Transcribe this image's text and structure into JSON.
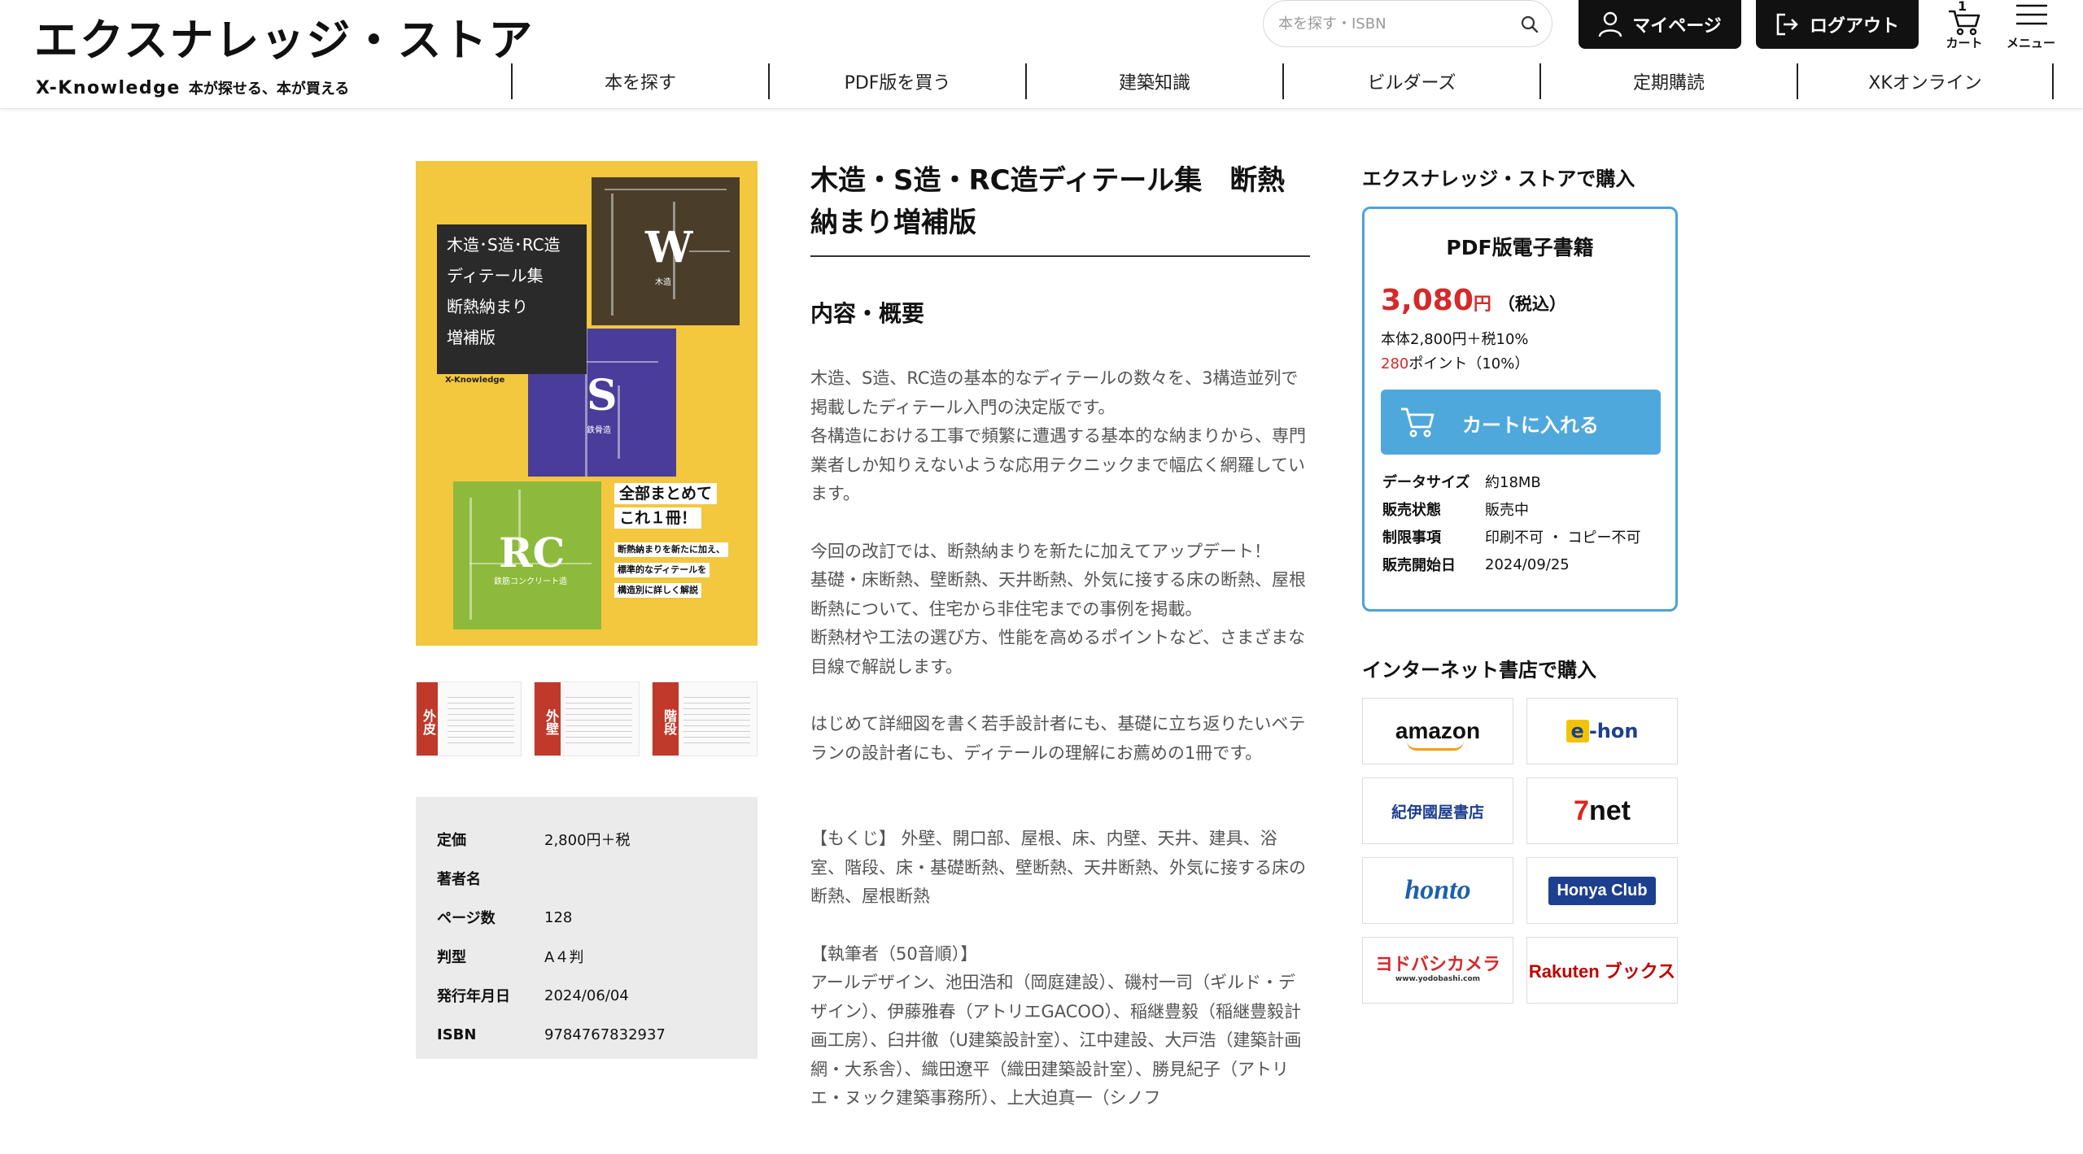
{
  "header": {
    "logo_text": "エクスナレッジ・ストア",
    "logo_brand": "X-Knowledge",
    "logo_tagline": "本が探せる、本が買える",
    "search_placeholder": "本を探す・ISBN",
    "mypage_label": "マイページ",
    "logout_label": "ログアウト",
    "cart_label": "カート",
    "cart_count": "1",
    "menu_label": "メニュー",
    "nav": [
      "本を探す",
      "PDF版を買う",
      "建築知識",
      "ビルダーズ",
      "定期購読",
      "XKオンライン"
    ]
  },
  "cover": {
    "title_lines": [
      "木造･S造･RC造",
      "ディテール集",
      "断熱納まり",
      "増補版"
    ],
    "letter_w": "W",
    "label_w": "木造",
    "letter_s": "S",
    "label_s": "鉄骨造",
    "letter_rc": "RC",
    "label_rc": "鉄筋コンクリート造",
    "publisher": "X-Knowledge",
    "promo_lines": [
      "全部まとめて",
      "これ１冊！"
    ],
    "promo_sub": [
      "断熱納まりを新たに加え、",
      "標準的なディテールを",
      "構造別に詳しく解説"
    ]
  },
  "thumbnails": [
    {
      "tab": "外皮"
    },
    {
      "tab": "外壁"
    },
    {
      "tab": "階段"
    }
  ],
  "specs": [
    {
      "key": "定価",
      "value": "2,800円＋税"
    },
    {
      "key": "著者名",
      "value": ""
    },
    {
      "key": "ページ数",
      "value": "128"
    },
    {
      "key": "判型",
      "value": "A４判"
    },
    {
      "key": "発行年月日",
      "value": "2024/06/04"
    },
    {
      "key": "ISBN",
      "value": "9784767832937"
    }
  ],
  "product": {
    "title": "木造・S造・RC造ディテール集　断熱納まり増補版",
    "section_heading": "内容・概要",
    "paragraphs": [
      "木造、S造、RC造の基本的なディテールの数々を、3構造並列で掲載したディテール入門の決定版です。",
      "各構造における工事で頻繁に遭遇する基本的な納まりから、専門業者しか知りえないような応用テクニックまで幅広く網羅しています。",
      "今回の改訂では、断熱納まりを新たに加えてアップデート！",
      "基礎・床断熱、壁断熱、天井断熱、外気に接する床の断熱、屋根断熱について、住宅から非住宅までの事例を掲載。",
      "断熱材や工法の選び方、性能を高めるポイントなど、さまざまな目線で解説します。",
      "はじめて詳細図を書く若手設計者にも、基礎に立ち返りたいベテランの設計者にも、ディテールの理解にお薦めの1冊です。",
      "【もくじ】 外壁、開口部、屋根、床、内壁、天井、建具、浴室、階段、床・基礎断熱、壁断熱、天井断熱、外気に接する床の断熱、屋根断熱",
      "【執筆者（50音順）】",
      "アールデザイン、池田浩和（岡庭建設）、磯村一司（ギルド・デザイン）、伊藤雅春（アトリエGACOO）、稲継豊毅（稲継豊毅計画工房）、臼井徹（U建築設計室）、江中建設、大戸浩（建築計画網・大系舎）、織田遼平（織田建築設計室）、勝見紀子（アトリエ・ヌック建築事務所）、上大迫真一（シノフ"
    ]
  },
  "purchase": {
    "heading": "エクスナレッジ・ストアで購入",
    "format": "PDF版電子書籍",
    "price": "3,080",
    "yen": "円",
    "tax_note": "（税込）",
    "price_breakdown": "本体2,800円＋税10%",
    "points_value": "280",
    "points_note": "ポイント（10%）",
    "cart_button": "カートに入れる",
    "meta": [
      {
        "key": "データサイズ",
        "value": "約18MB"
      },
      {
        "key": "販売状態",
        "value": "販売中"
      },
      {
        "key": "制限事項",
        "value": "印刷不可 ・ コピー不可"
      },
      {
        "key": "販売開始日",
        "value": "2024/09/25"
      }
    ]
  },
  "stores": {
    "heading": "インターネット書店で購入",
    "amazon": "amazon",
    "ehon_e": "e",
    "ehon_rest": "-hon",
    "kino": "紀伊國屋書店",
    "sevennet_7": "7",
    "sevennet_rest": "net",
    "honto": "honto",
    "honya": "Honya Club",
    "yodo": "ヨドバシカメラ",
    "yodo_url": "www.yodobashi.com",
    "rakuten": "Rakuten ブックス"
  },
  "colors": {
    "price_red": "#d42a2a",
    "cart_blue": "#4fa8dc",
    "box_border": "#4ba2d8",
    "cover_yellow": "#f3c73e"
  }
}
